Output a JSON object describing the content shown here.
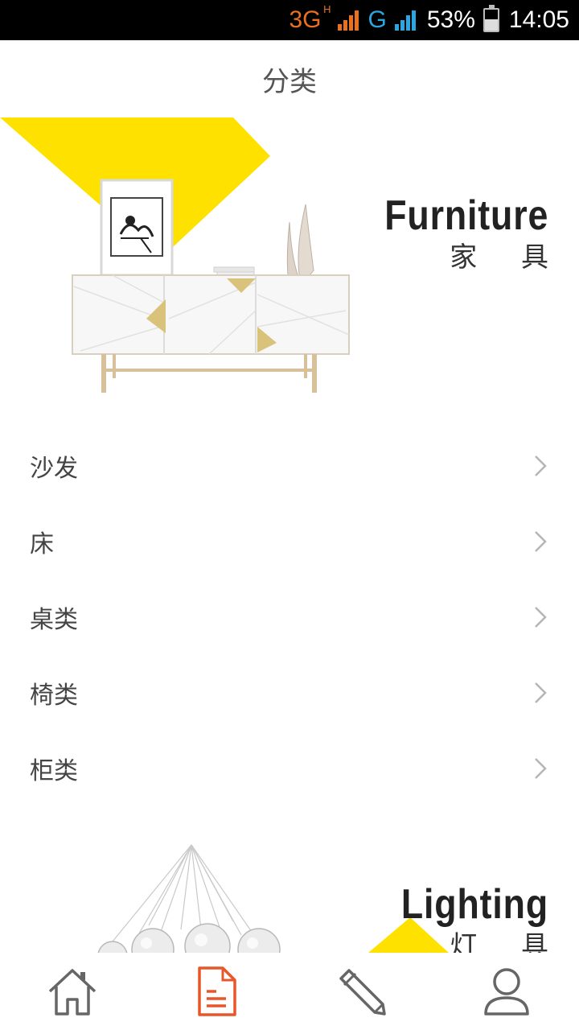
{
  "status_bar": {
    "network_1": "3G",
    "network_1_sup": "H",
    "network_2": "G",
    "battery": "53%",
    "battery_level": 0.53,
    "time": "14:05",
    "color_orange": "#e8701f",
    "color_blue": "#2aa6e0"
  },
  "header": {
    "title": "分类"
  },
  "furniture_banner": {
    "title_en": "Furniture",
    "title_cn": "家 具",
    "accent": "#ffe100"
  },
  "categories": [
    {
      "label": "沙发"
    },
    {
      "label": "床"
    },
    {
      "label": "桌类"
    },
    {
      "label": "椅类"
    },
    {
      "label": "柜类"
    }
  ],
  "lighting_banner": {
    "title_en": "Lighting",
    "title_cn": "灯 具"
  },
  "bottom_nav": {
    "active_color": "#e8572a",
    "items": [
      {
        "icon": "home-icon",
        "active": false
      },
      {
        "icon": "document-icon",
        "active": true
      },
      {
        "icon": "pencil-icon",
        "active": false
      },
      {
        "icon": "user-icon",
        "active": false
      }
    ]
  }
}
